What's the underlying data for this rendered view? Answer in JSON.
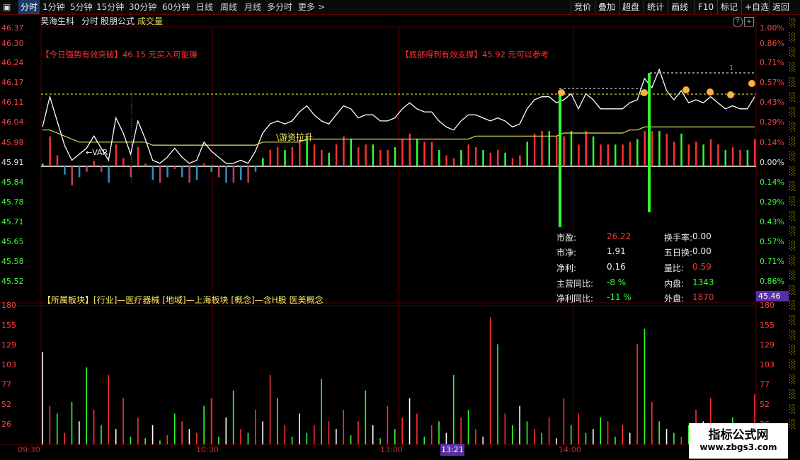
{
  "toolbar": {
    "left_items": [
      "分时",
      "1分钟",
      "5分钟",
      "15分钟",
      "30分钟",
      "60分钟",
      "日线",
      "周线",
      "月线",
      "多分时",
      "更多 >"
    ],
    "right_items": [
      "竞价",
      "叠加",
      "超盘",
      "统计",
      "画线",
      "F10",
      "标记",
      "+自选",
      "返回"
    ]
  },
  "header": {
    "stock_name": "昊海生科",
    "mode": "分时",
    "formula_name": "股朋公式",
    "volume_label": "成交量"
  },
  "price_axis": {
    "left": [
      "46.37",
      "46.30",
      "46.24",
      "46.17",
      "46.11",
      "46.04",
      "45.98",
      "45.91",
      "45.84",
      "45.78",
      "45.71",
      "45.65",
      "45.58",
      "45.52"
    ],
    "right": [
      "1.00%",
      "0.86%",
      "0.71%",
      "0.57%",
      "0.43%",
      "0.29%",
      "0.14%",
      "0.00%",
      "0.14%",
      "0.29%",
      "0.43%",
      "0.57%",
      "0.71%",
      "0.86%"
    ],
    "base_price": "45.91",
    "current_tag": "45.46"
  },
  "signals": {
    "breakout": "【今日强势有效突破】46.15 元买入可能赚",
    "support": "【底部得到有效支撑】45.92 元可以参考",
    "var_label": "←VAR",
    "hot_money": "\\游资拉升",
    "marker_one": "1"
  },
  "stats": [
    {
      "label": "市盈:",
      "value": "26.22",
      "color": "#ff3030"
    },
    {
      "label": "市净:",
      "value": "1.91",
      "color": "#f0f0f0"
    },
    {
      "label": "净利:",
      "value": "0.16",
      "color": "#f0f0f0"
    },
    {
      "label": "主营同比:",
      "value": "-8 %",
      "color": "#30ff30"
    },
    {
      "label": "净利同比:",
      "value": "-11 %",
      "color": "#30ff30"
    }
  ],
  "stats_right": [
    {
      "label": "换手率:",
      "value": "0.00",
      "color": "#f0f0f0"
    },
    {
      "label": "五日换:",
      "value": "0.00",
      "color": "#f0f0f0"
    },
    {
      "label": "量比:",
      "value": "0.59",
      "color": "#ff3030"
    },
    {
      "label": "内盘:",
      "value": "1343",
      "color": "#30ff30"
    },
    {
      "label": "外盘:",
      "value": "1870",
      "color": "#ff3030"
    }
  ],
  "sector": {
    "prefix": "【所属板块】",
    "text": "[行业]—医疗器械 [地域]—上海板块 [概念]—含H股 医美概念"
  },
  "volume_axis": [
    "180",
    "155",
    "129",
    "103",
    "77",
    "52",
    "26"
  ],
  "time_axis": [
    "09:30",
    "10:30",
    "13:00",
    "14:00"
  ],
  "cursor_time": "13:21",
  "watermark": {
    "title": "指标公式网",
    "url": "www.zbgs3.com"
  },
  "colors": {
    "up": "#ff3030",
    "down": "#30ff30",
    "price_line": "#ffffff",
    "avg_line": "#e0e060",
    "grid": "#5a0000"
  },
  "chart_data": {
    "type": "line",
    "price": [
      46.04,
      46.14,
      46.06,
      45.98,
      45.93,
      45.95,
      45.97,
      46.01,
      45.97,
      45.93,
      46.07,
      46.02,
      45.95,
      46.06,
      46.0,
      45.93,
      45.92,
      45.94,
      45.97,
      45.94,
      45.92,
      45.93,
      45.99,
      45.96,
      45.94,
      45.92,
      45.92,
      45.93,
      45.92,
      45.96,
      46.02,
      46.05,
      46.06,
      46.05,
      46.06,
      46.09,
      46.11,
      46.08,
      46.06,
      46.05,
      46.08,
      46.11,
      46.1,
      46.07,
      46.08,
      46.08,
      46.06,
      46.06,
      46.07,
      46.1,
      46.12,
      46.1,
      46.09,
      46.09,
      46.06,
      46.04,
      46.03,
      46.06,
      46.08,
      46.08,
      46.07,
      46.06,
      46.07,
      46.06,
      46.04,
      46.05,
      46.1,
      46.13,
      46.14,
      46.14,
      46.12,
      46.13,
      46.15,
      46.1,
      46.15,
      46.13,
      46.1,
      46.1,
      46.1,
      46.1,
      46.12,
      46.13,
      46.2,
      46.17,
      46.23,
      46.16,
      46.13,
      46.16,
      46.12,
      46.13,
      46.12,
      46.14,
      46.12,
      46.1,
      46.11,
      46.1,
      46.1,
      46.14
    ],
    "avg": [
      46.03,
      46.03,
      46.02,
      46.01,
      46.0,
      45.99,
      45.99,
      45.99,
      45.99,
      45.99,
      45.99,
      45.99,
      45.99,
      45.99,
      45.99,
      45.98,
      45.98,
      45.98,
      45.98,
      45.98,
      45.98,
      45.98,
      45.98,
      45.98,
      45.98,
      45.98,
      45.98,
      45.98,
      45.98,
      45.98,
      45.99,
      45.99,
      45.99,
      45.99,
      45.99,
      45.99,
      46.0,
      46.0,
      46.0,
      46.0,
      46.0,
      46.0,
      46.0,
      46.0,
      46.0,
      46.0,
      46.0,
      46.0,
      46.0,
      46.0,
      46.0,
      46.0,
      46.0,
      46.0,
      46.0,
      46.0,
      46.0,
      46.0,
      46.0,
      46.01,
      46.01,
      46.01,
      46.01,
      46.01,
      46.01,
      46.01,
      46.01,
      46.01,
      46.01,
      46.01,
      46.01,
      46.02,
      46.02,
      46.02,
      46.02,
      46.02,
      46.02,
      46.02,
      46.02,
      46.02,
      46.03,
      46.03,
      46.04,
      46.04,
      46.04,
      46.04,
      46.04,
      46.04,
      46.04,
      46.04,
      46.04,
      46.04,
      46.04,
      46.04,
      46.04,
      46.04,
      46.04,
      46.04
    ],
    "ylim": [
      45.52,
      46.37
    ],
    "base": 45.91,
    "volume": [
      120,
      50,
      40,
      15,
      55,
      30,
      100,
      45,
      25,
      90,
      20,
      60,
      10,
      35,
      8,
      25,
      5,
      12,
      40,
      30,
      20,
      15,
      50,
      60,
      10,
      35,
      70,
      20,
      15,
      45,
      30,
      90,
      60,
      25,
      10,
      40,
      15,
      25,
      85,
      30,
      20,
      45,
      12,
      30,
      70,
      25,
      8,
      50,
      20,
      35,
      60,
      40,
      10,
      25,
      30,
      15,
      90,
      35,
      45,
      20,
      10,
      165,
      130,
      40,
      25,
      50,
      30,
      20,
      15,
      35,
      8,
      60,
      25,
      40,
      15,
      20,
      35,
      30,
      10,
      25,
      15,
      130,
      150,
      55,
      30,
      20,
      15,
      10,
      25,
      45,
      30,
      60,
      20,
      12,
      35,
      20,
      25,
      65
    ],
    "volume_ylim": [
      0,
      180
    ]
  }
}
